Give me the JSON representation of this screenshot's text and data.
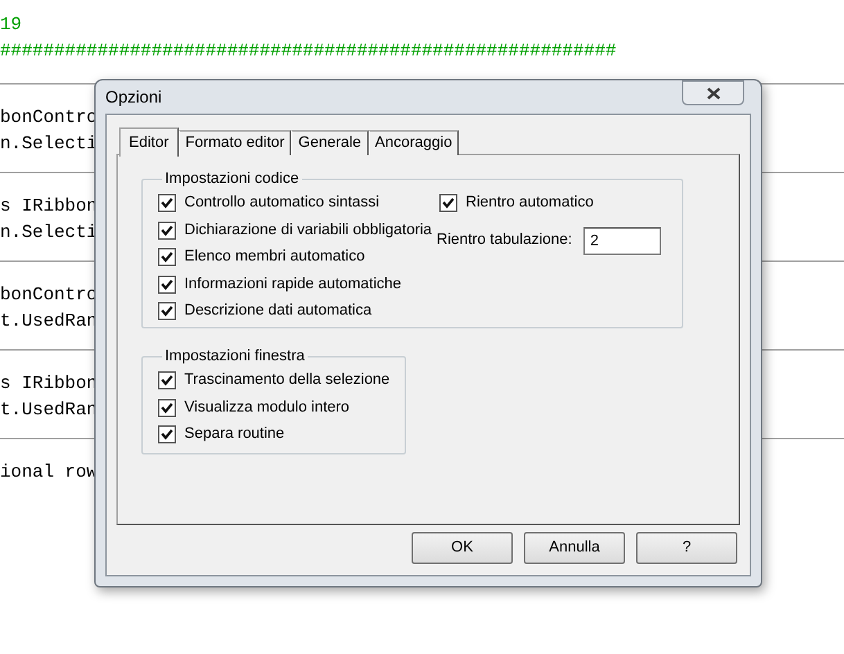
{
  "editor": {
    "blocks": [
      {
        "lines": [
          {
            "kind": "comment",
            "text": "19"
          },
          {
            "kind": "comment",
            "text": "#########################################################"
          }
        ]
      },
      {
        "lines": [
          {
            "kind": "code",
            "text": "bonContro"
          },
          {
            "kind": "code",
            "text": "n.Selecti"
          }
        ]
      },
      {
        "lines": [
          {
            "kind": "code",
            "text": "s IRibbon"
          },
          {
            "kind": "code",
            "text": "n.Selecti"
          }
        ]
      },
      {
        "lines": [
          {
            "kind": "code",
            "text": "bonContro"
          },
          {
            "kind": "code",
            "text": "t.UsedRan"
          }
        ]
      },
      {
        "lines": [
          {
            "kind": "code",
            "text": "s IRibbon"
          },
          {
            "kind": "code",
            "text": "t.UsedRan"
          }
        ]
      },
      {
        "lines": [
          {
            "kind": "code",
            "text": "ional row"
          }
        ]
      }
    ]
  },
  "dialog": {
    "title": "Opzioni",
    "tabs": [
      {
        "label": "Editor",
        "selected": true
      },
      {
        "label": "Formato editor",
        "selected": false
      },
      {
        "label": "Generale",
        "selected": false
      },
      {
        "label": "Ancoraggio",
        "selected": false
      }
    ],
    "code_settings": {
      "title": "Impostazioni codice",
      "options": [
        {
          "label": "Controllo automatico sintassi",
          "checked": true
        },
        {
          "label": "Dichiarazione di variabili obbligatoria",
          "checked": true
        },
        {
          "label": "Elenco membri automatico",
          "checked": true
        },
        {
          "label": "Informazioni rapide automatiche",
          "checked": true
        },
        {
          "label": "Descrizione dati automatica",
          "checked": true
        }
      ],
      "auto_indent": {
        "label": "Rientro automatico",
        "checked": true
      },
      "tab_width": {
        "label": "Rientro tabulazione:",
        "value": "2"
      }
    },
    "window_settings": {
      "title": "Impostazioni finestra",
      "options": [
        {
          "label": "Trascinamento della selezione",
          "checked": true
        },
        {
          "label": "Visualizza modulo intero",
          "checked": true
        },
        {
          "label": "Separa routine",
          "checked": true
        }
      ]
    },
    "buttons": [
      "OK",
      "Annulla",
      "?"
    ]
  }
}
